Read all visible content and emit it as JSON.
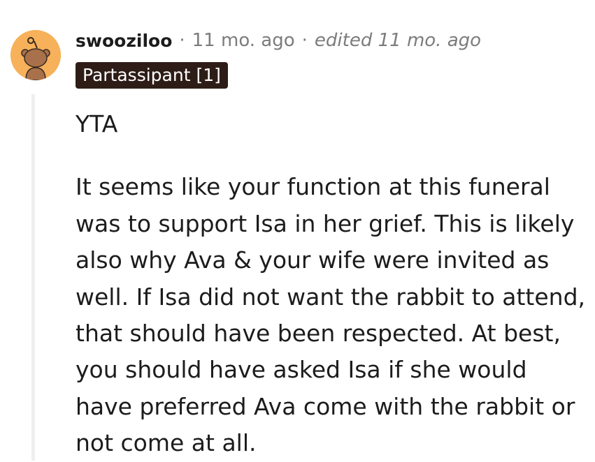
{
  "comment": {
    "author": "swooziloo",
    "separator": "·",
    "timestamp": "11 mo. ago",
    "edited": "edited 11 mo. ago",
    "flair": "Partassipant [1]",
    "avatar_icon": "snoo-avatar-icon",
    "paragraphs": [
      "YTA",
      "It seems like your function at this funeral was to support Isa in her grief. This is likely also why Ava & your wife were invited as well. If Isa did not want the rabbit to attend, that should have been respected. At best, you should have asked Isa if she would have preferred Ava come with the rabbit or not come at all."
    ]
  },
  "colors": {
    "avatar_bg": "#f6b15a",
    "flair_bg": "#2e1d17",
    "flair_text": "#ffffff",
    "meta_text": "#7c7c7c",
    "thread_line": "#edeff1"
  }
}
